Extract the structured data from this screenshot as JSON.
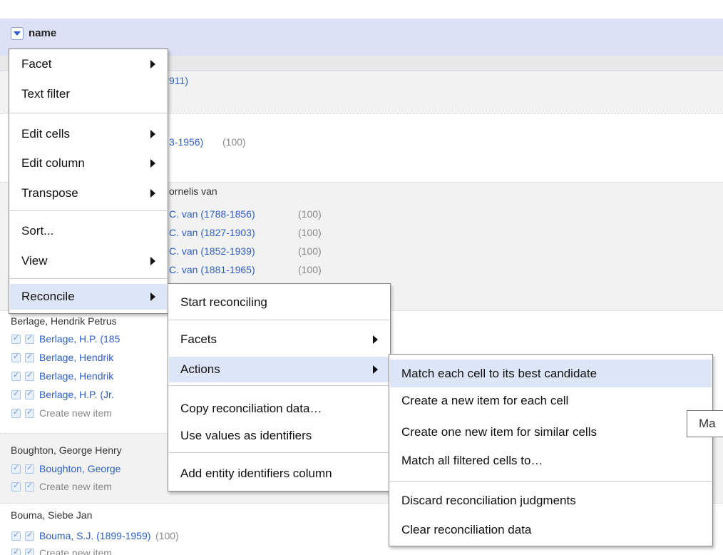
{
  "column": {
    "name": "name"
  },
  "grid": {
    "row1": {
      "link": "911)"
    },
    "row2": {
      "link": "3-1956)",
      "score": "(100)"
    },
    "row3": {
      "title": "ornelis van",
      "items": [
        {
          "link": "C. van (1788-1856)",
          "score": "(100)"
        },
        {
          "link": "C. van (1827-1903)",
          "score": "(100)"
        },
        {
          "link": "C. van (1852-1939)",
          "score": "(100)"
        },
        {
          "link": "C. van (1881-1965)",
          "score": "(100)"
        }
      ]
    },
    "row4": {
      "title": "Berlage, Hendrik Petrus",
      "items": [
        "Berlage, H.P. (185",
        "Berlage, Hendrik",
        "Berlage, Hendrik",
        "Berlage, H.P. (Jr."
      ],
      "create": "Create new item"
    },
    "row5": {
      "title": "Boughton, George Henry",
      "item": "Boughton, George",
      "create": "Create new item"
    },
    "row6": {
      "title": "Bouma, Siebe Jan",
      "link": "Bouma, S.J. (1899-1959)",
      "score": "(100)",
      "create": "Create new item"
    }
  },
  "menus": {
    "main": {
      "facet": "Facet",
      "text_filter": "Text filter",
      "edit_cells": "Edit cells",
      "edit_column": "Edit column",
      "transpose": "Transpose",
      "sort": "Sort...",
      "view": "View",
      "reconcile": "Reconcile"
    },
    "reconcile": {
      "start": "Start reconciling",
      "facets": "Facets",
      "actions": "Actions",
      "copy": "Copy reconciliation data…",
      "use_values": "Use values as identifiers",
      "add_entity": "Add entity identifiers column"
    },
    "actions": {
      "match_best": "Match each cell to its best candidate",
      "create_each": "Create a new item for each cell",
      "create_similar": "Create one new item for similar cells",
      "match_all": "Match all filtered cells to…",
      "discard": "Discard reconciliation judgments",
      "clear": "Clear reconciliation data"
    }
  },
  "tooltip": {
    "text": "Ma"
  },
  "colors": {
    "accent": "#2d5fc2",
    "menu_hover": "#dde6f6",
    "header": "#dde1f5"
  }
}
